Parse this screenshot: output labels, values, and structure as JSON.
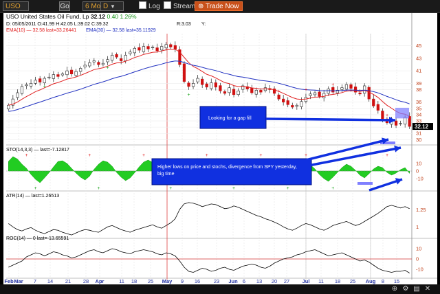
{
  "toolbar": {
    "symbol": "USO",
    "go_label": "Go",
    "range": "6 Mo",
    "interval": "D",
    "log_label": "Log",
    "stream_label": "Stream",
    "trade_label": "Trade Now",
    "log_checked": true,
    "stream_checked": true
  },
  "header": {
    "name": "USO United States Oil Fund, Lp",
    "last": "32.12",
    "change": "0.40",
    "change_pct": "1.26%",
    "ohlc": "D: 05/05/2011 O:41.99 H:42.05 L:39.02 C:39.32",
    "r_label": "R:3.03",
    "y_label": "Y:",
    "ema10": "EMA(10) — 32.58 last=33.26441",
    "ema30": "EMA(30) — 32.58 last=35.11929"
  },
  "panels": {
    "sto_label": "STO(14,3,3) — last=-7.12817",
    "atr_label": "ATR(14) — last=1.26513",
    "roc_label": "ROC(14) — 0 last=-13.65591"
  },
  "annotations": {
    "gap_fill": "Looking for a gap fill",
    "higher_lows": "Higher lows on price and stochs, divergence from SPY yesterday, big time"
  },
  "colors": {
    "accent": "#e07020",
    "ema10": "#e02020",
    "ema30": "#2030c0",
    "annotation_fill": "#1030e0",
    "sto_green": "#22cc22"
  },
  "chart_data": [
    {
      "type": "candlestick",
      "title": "USO United States Oil Fund, Lp",
      "x_labels": [
        "Feb",
        "Mar",
        "7",
        "14",
        "21",
        "28",
        "Apr",
        "11",
        "18",
        "25",
        "May",
        "9",
        "16",
        "23",
        "Jun",
        "6",
        "13",
        "20",
        "27",
        "Jul",
        "11",
        "18",
        "25",
        "Aug",
        "8",
        "15"
      ],
      "y_ticks": [
        45,
        43,
        41,
        39,
        38,
        36,
        35,
        34,
        33,
        32,
        31,
        30
      ],
      "last_price_tag": "32.12",
      "close": [
        35.5,
        36.5,
        37.5,
        38.5,
        38.8,
        39.0,
        39.5,
        39.2,
        39.8,
        40.0,
        40.4,
        40.1,
        40.5,
        41.0,
        40.5,
        40.9,
        41.4,
        41.9,
        42.3,
        42.6,
        42.0,
        42.2,
        42.8,
        43.5,
        43.2,
        42.6,
        43.5,
        44.0,
        44.6,
        44.3,
        44.9,
        44.5,
        44.8,
        44.2,
        44.9,
        45.2,
        44.8,
        44.5,
        42.0,
        39.3,
        38.5,
        39.0,
        39.8,
        38.8,
        38.4,
        39.1,
        38.4,
        37.8,
        37.4,
        38.3,
        37.2,
        37.8,
        38.6,
        38.1,
        37.5,
        37.9,
        37.6,
        38.3,
        38.0,
        37.4,
        36.5,
        36.0,
        35.6,
        35.2,
        35.5,
        36.1,
        36.8,
        37.3,
        37.5,
        36.9,
        37.4,
        38.1,
        37.6,
        37.9,
        38.3,
        38.8,
        38.2,
        37.6,
        37.3,
        38.6,
        36.5,
        35.4,
        34.7,
        33.2,
        32.7,
        33.0,
        32.3,
        32.6,
        33.6,
        32.12
      ],
      "series": [
        {
          "name": "EMA(10)",
          "last": 33.26441
        },
        {
          "name": "EMA(30)",
          "last": 35.11929
        }
      ]
    },
    {
      "type": "area",
      "title": "STO(14,3,3)",
      "last": -7.12817,
      "y_ticks": [
        10,
        0,
        -10
      ],
      "values": [
        28,
        42,
        35,
        20,
        8,
        -10,
        -24,
        -34,
        -20,
        -5,
        12,
        28,
        30,
        22,
        8,
        -6,
        -18,
        -26,
        -15,
        5,
        20,
        30,
        26,
        14,
        -4,
        -18,
        -28,
        -20,
        -5,
        12,
        26,
        32,
        25,
        10,
        -8,
        -22,
        -36,
        -30,
        -12,
        4,
        18,
        28,
        22,
        6,
        -10,
        -24,
        -16,
        -2,
        14,
        24,
        20,
        8,
        -8,
        -18,
        -10,
        5,
        18,
        26,
        22,
        10,
        -6,
        -20,
        -26,
        -14,
        2,
        16,
        24,
        18,
        6,
        -10,
        -22,
        -30,
        -18,
        -4,
        10,
        20,
        14,
        2,
        -12,
        -20,
        -8,
        6,
        14,
        10,
        -4,
        -12,
        -6,
        4,
        10,
        -7
      ]
    },
    {
      "type": "line",
      "title": "ATR(14)",
      "last": 1.26513,
      "y_ticks": [
        1.25,
        1
      ],
      "values": [
        1.05,
        1.0,
        0.96,
        0.94,
        0.97,
        0.99,
        0.95,
        0.92,
        0.9,
        0.93,
        0.96,
        0.95,
        0.92,
        0.9,
        0.88,
        0.91,
        0.94,
        0.96,
        0.95,
        0.93,
        0.92,
        0.96,
        1.0,
        1.02,
        0.99,
        0.96,
        0.94,
        0.92,
        0.95,
        0.97,
        0.99,
        1.01,
        1.03,
        1.0,
        0.98,
        1.02,
        1.06,
        1.12,
        1.26,
        1.34,
        1.36,
        1.35,
        1.33,
        1.3,
        1.32,
        1.34,
        1.33,
        1.3,
        1.27,
        1.28,
        1.31,
        1.29,
        1.26,
        1.23,
        1.2,
        1.17,
        1.15,
        1.12,
        1.1,
        1.07,
        1.04,
        1.0,
        0.97,
        0.95,
        0.98,
        1.02,
        1.05,
        1.03,
        1.0,
        0.97,
        0.95,
        0.98,
        1.02,
        1.04,
        1.06,
        1.08,
        1.05,
        1.02,
        1.04,
        1.08,
        1.12,
        1.16,
        1.2,
        1.25,
        1.3,
        1.32,
        1.3,
        1.28,
        1.3,
        1.27
      ]
    },
    {
      "type": "line",
      "title": "ROC(14)",
      "last": -13.65591,
      "y_ticks": [
        10,
        0,
        -10
      ],
      "values": [
        -8,
        -6,
        -4,
        -2,
        2,
        4,
        6,
        5,
        3,
        5,
        7,
        6,
        4,
        3,
        1,
        2,
        4,
        6,
        8,
        9,
        7,
        6,
        8,
        10,
        9,
        7,
        6,
        5,
        7,
        8,
        9,
        8,
        7,
        5,
        4,
        6,
        5,
        3,
        -2,
        -8,
        -12,
        -13,
        -11,
        -9,
        -10,
        -12,
        -11,
        -9,
        -8,
        -10,
        -11,
        -9,
        -7,
        -6,
        -5,
        -6,
        -8,
        -9,
        -7,
        -4,
        -2,
        0,
        1,
        2,
        4,
        5,
        7,
        8,
        9,
        7,
        5,
        3,
        4,
        5,
        6,
        4,
        2,
        0,
        -2,
        -1,
        -3,
        -6,
        -9,
        -11,
        -12,
        -13,
        -12,
        -12,
        -11,
        -13.66
      ]
    }
  ]
}
